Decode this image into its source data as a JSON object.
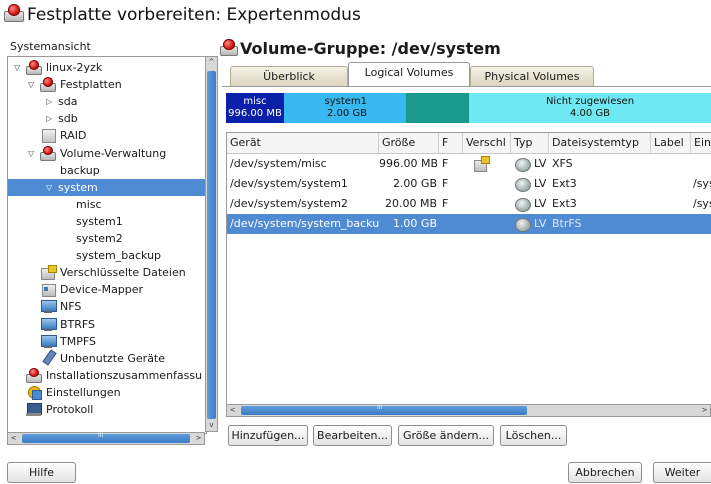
{
  "title": "Festplatte vorbereiten: Expertenmodus",
  "left": {
    "label": "Systemansicht",
    "tree": [
      {
        "label": "linux-2yzk",
        "depth": 0,
        "icon": "computer-icon",
        "arrow": "▽"
      },
      {
        "label": "Festplatten",
        "depth": 1,
        "icon": "hard-disk-icon",
        "arrow": "▽"
      },
      {
        "label": "sda",
        "depth": 2,
        "icon": "",
        "arrow": "▷"
      },
      {
        "label": "sdb",
        "depth": 2,
        "icon": "",
        "arrow": "▷"
      },
      {
        "label": "RAID",
        "depth": 1,
        "icon": "raid-icon",
        "arrow": ""
      },
      {
        "label": "Volume-Verwaltung",
        "depth": 1,
        "icon": "hard-disk-icon",
        "arrow": "▽"
      },
      {
        "label": "backup",
        "depth": 2,
        "icon": "",
        "arrow": ""
      },
      {
        "label": "system",
        "depth": 2,
        "icon": "",
        "arrow": "▽",
        "selected": true
      },
      {
        "label": "misc",
        "depth": 3,
        "icon": "",
        "arrow": ""
      },
      {
        "label": "system1",
        "depth": 3,
        "icon": "",
        "arrow": ""
      },
      {
        "label": "system2",
        "depth": 3,
        "icon": "",
        "arrow": ""
      },
      {
        "label": "system_backup",
        "depth": 3,
        "icon": "",
        "arrow": ""
      },
      {
        "label": "Verschlüsselte Dateien",
        "depth": 1,
        "icon": "encrypted-icon",
        "arrow": ""
      },
      {
        "label": "Device-Mapper",
        "depth": 1,
        "icon": "device-mapper-icon",
        "arrow": ""
      },
      {
        "label": "NFS",
        "depth": 1,
        "icon": "nfs-icon",
        "arrow": ""
      },
      {
        "label": "BTRFS",
        "depth": 1,
        "icon": "btrfs-icon",
        "arrow": ""
      },
      {
        "label": "TMPFS",
        "depth": 1,
        "icon": "tmpfs-icon",
        "arrow": ""
      },
      {
        "label": "Unbenutzte Geräte",
        "depth": 1,
        "icon": "unused-devices-icon",
        "arrow": ""
      },
      {
        "label": "Installationszusammenfassu",
        "depth": 0,
        "icon": "summary-icon",
        "arrow": ""
      },
      {
        "label": "Einstellungen",
        "depth": 0,
        "icon": "settings-icon",
        "arrow": ""
      },
      {
        "label": "Protokoll",
        "depth": 0,
        "icon": "log-icon",
        "arrow": ""
      }
    ],
    "hscroll_grip": "III"
  },
  "right": {
    "vg_title": "Volume-Gruppe: /dev/system",
    "tabs": [
      {
        "label": "Überblick",
        "active": false
      },
      {
        "label": "Logical Volumes",
        "active": true
      },
      {
        "label": "Physical Volumes",
        "active": false
      }
    ],
    "bar": [
      {
        "name": "misc",
        "size": "996.00 MB",
        "color": "#0a20a8",
        "text_color": "#ffffff"
      },
      {
        "name": "system1",
        "size": "2.00 GB",
        "color": "#38b8f0",
        "text_color": "#111111"
      },
      {
        "name": "",
        "size": "",
        "color": "#1a9a8c",
        "text_color": "#111111"
      },
      {
        "name": "Nicht zugewiesen",
        "size": "4.00 GB",
        "color": "#6ee8f2",
        "text_color": "#111111"
      }
    ],
    "columns": [
      "Gerät",
      "Größe",
      "F",
      "Verschl",
      "Typ",
      "Dateisystemtyp",
      "Label",
      "Einh"
    ],
    "rows": [
      {
        "device": "/dev/system/misc",
        "size": "996.00 MB",
        "f": "F",
        "enc": true,
        "type": "LV",
        "fs": "XFS",
        "label": "",
        "mount": "",
        "selected": false
      },
      {
        "device": "/dev/system/system1",
        "size": "2.00 GB",
        "f": "F",
        "enc": false,
        "type": "LV",
        "fs": "Ext3",
        "label": "",
        "mount": "/sys",
        "selected": false
      },
      {
        "device": "/dev/system/system2",
        "size": "20.00 MB",
        "f": "F",
        "enc": false,
        "type": "LV",
        "fs": "Ext3",
        "label": "",
        "mount": "/sys",
        "selected": false
      },
      {
        "device": "/dev/system/system_backup",
        "size": "1.00 GB",
        "f": "",
        "enc": false,
        "type": "LV",
        "fs": "BtrFS",
        "label": "",
        "mount": "",
        "selected": true
      }
    ],
    "hscroll_grip": "III",
    "buttons": {
      "add": "Hinzufügen...",
      "edit": "Bearbeiten...",
      "resize": "Größe ändern...",
      "delete": "Löschen..."
    }
  },
  "footer": {
    "help": "Hilfe",
    "cancel": "Abbrechen",
    "next": "Weiter"
  }
}
